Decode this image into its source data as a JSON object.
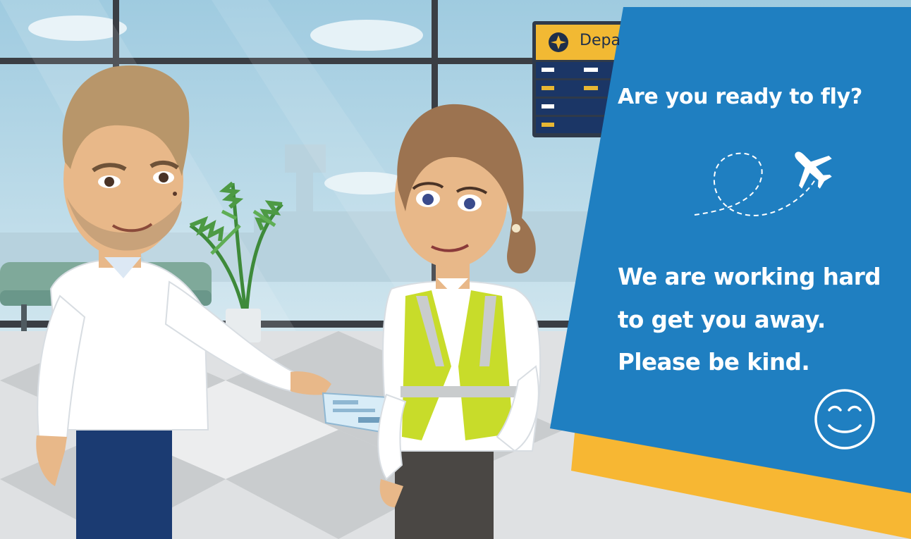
{
  "board": {
    "title": "Depa"
  },
  "banner": {
    "headline": "Are you ready to fly?",
    "message_lines": [
      "We are working hard",
      "to get you away.",
      "Please be kind."
    ],
    "icons": {
      "flight": "airplane-icon",
      "path": "dashed-flight-path",
      "face": "smiley-wink-icon"
    }
  },
  "colors": {
    "banner_blue": "#1f7fc1",
    "accent_yellow": "#f7b733",
    "vest_yellow": "#c8dc2a",
    "trousers_navy": "#1b3b72"
  }
}
